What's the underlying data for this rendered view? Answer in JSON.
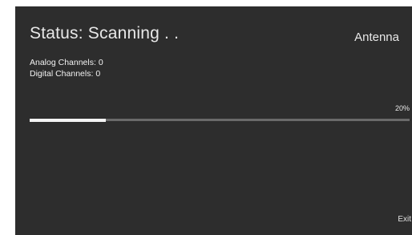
{
  "status": {
    "text": "Status: Scanning . ."
  },
  "source": {
    "label": "Antenna"
  },
  "channels": {
    "analog_label": "Analog Channels:",
    "analog_count": "0",
    "digital_label": "Digital Channels:",
    "digital_count": "0"
  },
  "progress": {
    "percent_text": "20%",
    "fraction": 0.2
  },
  "actions": {
    "exit_label": "Exit"
  },
  "colors": {
    "background": "#2d2d2d",
    "track": "#6a6a6a",
    "fill": "#f4f4f4"
  }
}
